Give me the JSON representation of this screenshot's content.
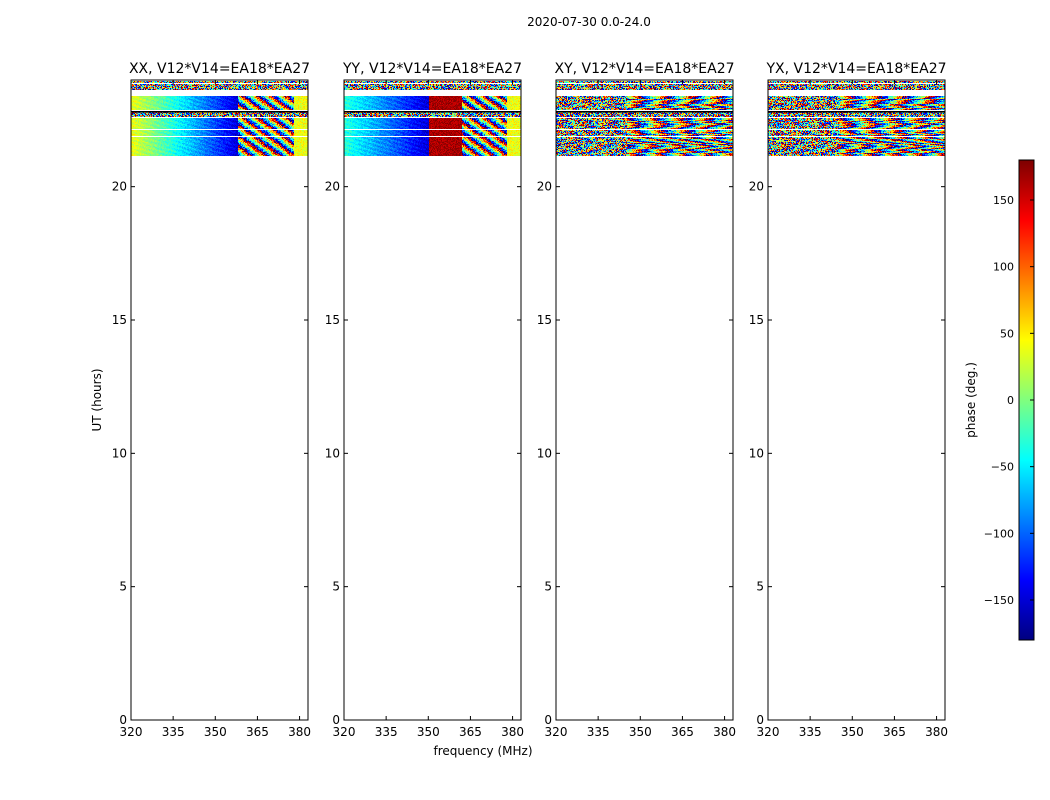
{
  "chart_data": {
    "type": "heatmap",
    "title": "2020-07-30 0.0-24.0",
    "xlabel": "frequency (MHz)",
    "ylabel": "UT (hours)",
    "xlim": [
      320,
      383
    ],
    "ylim": [
      0,
      24
    ],
    "xticks": [
      "320",
      "335",
      "350",
      "365",
      "380"
    ],
    "yticks": [
      "0",
      "5",
      "10",
      "15",
      "20"
    ],
    "colorbar": {
      "label": "phase (deg.)",
      "range": [
        -180,
        180
      ],
      "ticks": [
        "−150",
        "−100",
        "−50",
        "0",
        "50",
        "100",
        "150"
      ],
      "tick_values": [
        -150,
        -100,
        -50,
        0,
        50,
        100,
        150
      ],
      "colormap": "jet"
    },
    "data_segments_ut": [
      {
        "start": 23.9,
        "end": 23.98,
        "kind": "noisy"
      },
      {
        "start": 23.62,
        "end": 23.85,
        "kind": "noisy"
      },
      {
        "start": 22.88,
        "end": 23.4,
        "kind": "data"
      },
      {
        "start": 22.6,
        "end": 22.8,
        "kind": "noisy"
      },
      {
        "start": 22.15,
        "end": 22.57,
        "kind": "data"
      },
      {
        "start": 21.9,
        "end": 22.12,
        "kind": "data"
      },
      {
        "start": 21.15,
        "end": 21.87,
        "kind": "data"
      }
    ],
    "panels": [
      {
        "title": "XX, V12*V14=EA18*EA27",
        "model": "parallel",
        "phase_at_320": 40,
        "phase_slope_deg_per_mhz": -5,
        "smooth_until_mhz": 358,
        "edge_phase_above_mhz": 378
      },
      {
        "title": "YY, V12*V14=EA18*EA27",
        "model": "parallel",
        "phase_at_320": -30,
        "phase_slope_deg_per_mhz": -4,
        "smooth_until_mhz": 350,
        "edge_phase_above_mhz": 378
      },
      {
        "title": "XY, V12*V14=EA18*EA27",
        "model": "cross"
      },
      {
        "title": "YX, V12*V14=EA18*EA27",
        "model": "cross"
      }
    ]
  }
}
